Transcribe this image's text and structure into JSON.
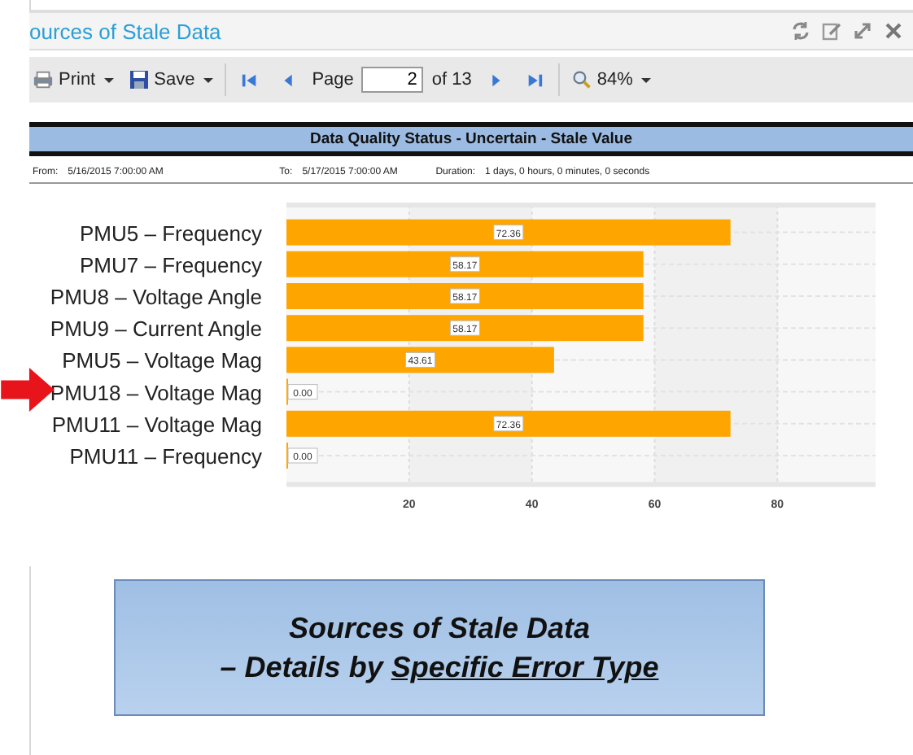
{
  "window": {
    "title": "ources of Stale Data"
  },
  "toolbar": {
    "print": "Print",
    "save": "Save",
    "page_label": "Page",
    "page_value": "2",
    "page_total": "of 13",
    "zoom": "84%"
  },
  "report": {
    "heading": "Data Quality Status - Uncertain - Stale Value",
    "from_label": "From:",
    "from_value": "5/16/2015 7:00:00 AM",
    "to_label": "To:",
    "to_value": "5/17/2015 7:00:00 AM",
    "duration_label": "Duration:",
    "duration_value": "1 days, 0 hours, 0 minutes, 0 seconds",
    "chart_data": {
      "type": "bar",
      "orientation": "horizontal",
      "categories": [
        "PMU5 – Frequency",
        "PMU7 – Frequency",
        "PMU8 – Voltage Angle",
        "PMU9 – Current Angle",
        "PMU5 – Voltage Mag",
        "PMU18 – Voltage Mag",
        "PMU11 – Voltage Mag",
        "PMU11 – Frequency"
      ],
      "series": [
        {
          "color": "#ffa500",
          "values": [
            72.36,
            58.17,
            58.17,
            58.17,
            43.61,
            0,
            72.36,
            0
          ]
        }
      ],
      "value_labels": [
        "72.36",
        "58.17",
        "58.17",
        "58.17",
        "43.61",
        "0.00",
        "72.36",
        "0.00"
      ],
      "grid": true,
      "xlim": [
        0,
        96
      ],
      "xticks": [
        20,
        40,
        60,
        80
      ]
    }
  },
  "callout": {
    "title": "Sources of Stale Data",
    "subtitle": "– Details by ",
    "subtitle_underlined": "Specific Error Type"
  }
}
